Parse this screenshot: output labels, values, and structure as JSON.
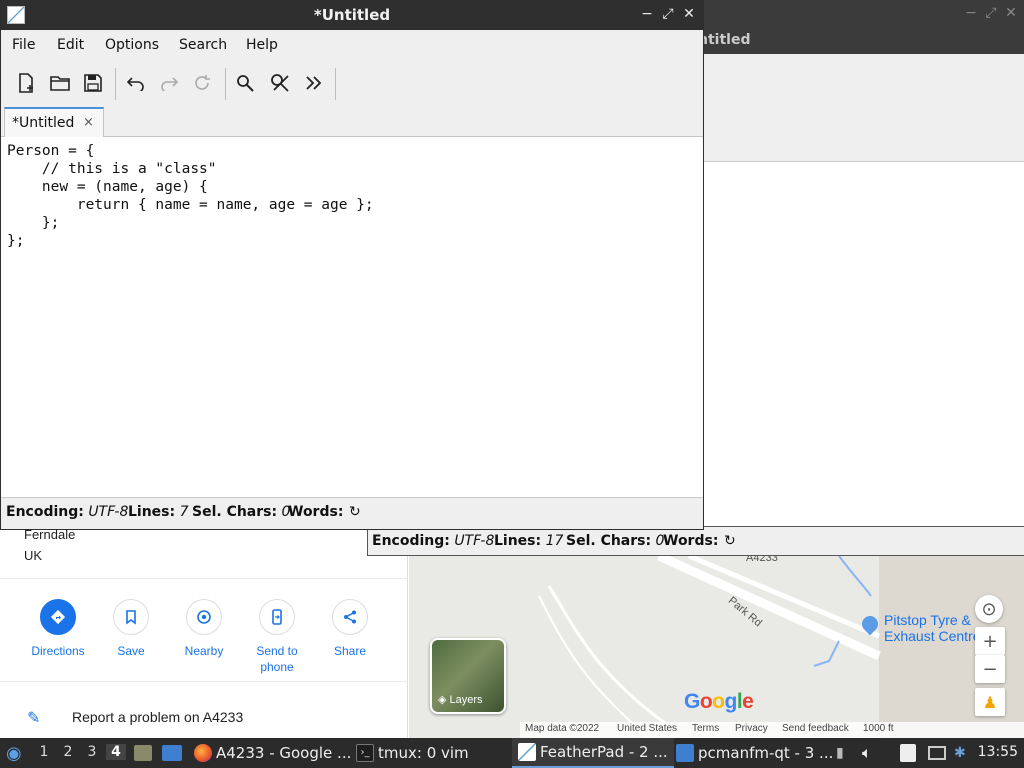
{
  "editor_window": {
    "title": "*Untitled",
    "menu": [
      "File",
      "Edit",
      "Options",
      "Search",
      "Help"
    ],
    "toolbar_icons": [
      "new-file-icon",
      "open-folder-icon",
      "save-icon",
      "undo-icon",
      "redo-icon",
      "redo-all-icon",
      "find-icon",
      "find-replace-icon",
      "more-icon"
    ],
    "tab_label": "*Untitled",
    "tab_close": "×",
    "code": "Person = {\n    // this is a \"class\"\n    new = (name, age) {\n        return { name = name, age = age };\n    };\n};",
    "status": {
      "encoding_label": "Encoding:",
      "encoding_value": "UTF-8",
      "lines_label": "Lines:",
      "lines_value": "7",
      "sel_label": "Sel. Chars:",
      "sel_value": "0",
      "words_label": "Words:"
    }
  },
  "second_editor": {
    "title_fragment": "ntitled",
    "status": {
      "encoding_label": "Encoding:",
      "encoding_value": "UTF-8",
      "lines_label": "Lines:",
      "lines_value": "17",
      "sel_label": "Sel. Chars:",
      "sel_value": "0",
      "words_label": "Words:"
    }
  },
  "maps": {
    "address_lines": [
      "Ferndale",
      "UK"
    ],
    "actions": [
      {
        "label": "Directions",
        "icon": "directions-icon"
      },
      {
        "label": "Save",
        "icon": "bookmark-icon"
      },
      {
        "label": "Nearby",
        "icon": "nearby-icon"
      },
      {
        "label": "Send to\nphone",
        "icon": "phone-icon"
      },
      {
        "label": "Share",
        "icon": "share-icon"
      }
    ],
    "report_text": "Report a problem on A4233",
    "road_label_1": "A4233",
    "road_label_2": "Park Rd",
    "poi_line1": "Pitstop Tyre &",
    "poi_line2": "Exhaust Centre",
    "layers_label": "Layers",
    "logo": "Google",
    "footer": [
      "Map data ©2022",
      "United States",
      "Terms",
      "Privacy",
      "Send feedback",
      "1000 ft"
    ]
  },
  "taskbar": {
    "workspaces": [
      "1",
      "2",
      "3",
      "4"
    ],
    "active_workspace": "4",
    "tasks": [
      "A4233 - Google ...",
      "tmux: 0 vim",
      "FeatherPad - 2 ...",
      "pcmanfm-qt - 3 ..."
    ],
    "clock": "13:55"
  },
  "colors": {
    "accent": "#4a90d9",
    "maps_blue": "#1a73e8",
    "titlebar": "#2f2f2f"
  }
}
